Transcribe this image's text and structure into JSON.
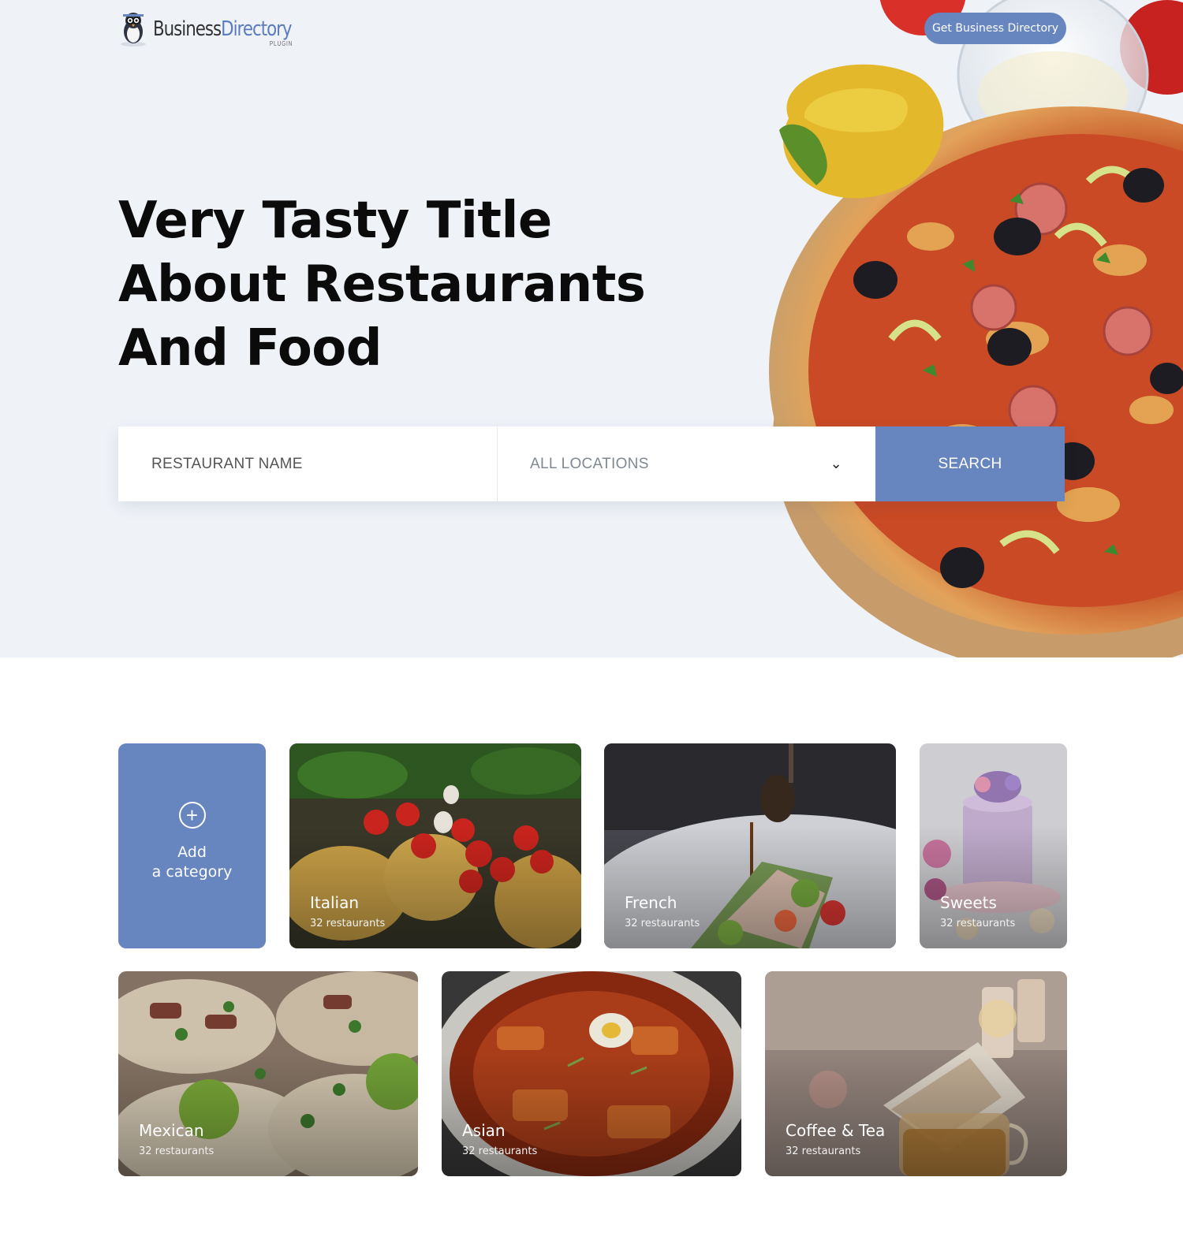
{
  "header": {
    "logo_primary": "Business",
    "logo_accent": "Directory",
    "logo_sub": "PLUGIN",
    "cta_label": "Get Business Directory"
  },
  "hero": {
    "title_lines": [
      "Very Tasty Title",
      "About Restaurants",
      "And Food"
    ]
  },
  "search": {
    "name_placeholder": "RESTAURANT NAME",
    "location_value": "ALL LOCATIONS",
    "button_label": "SEARCH"
  },
  "categories": {
    "add_line1": "Add",
    "add_line2": "a category",
    "items": [
      {
        "name": "Italian",
        "count": "32 restaurants"
      },
      {
        "name": "French",
        "count": "32 restaurants"
      },
      {
        "name": "Sweets",
        "count": "32 restaurants"
      },
      {
        "name": "Mexican",
        "count": "32 restaurants"
      },
      {
        "name": "Asian",
        "count": "32 restaurants"
      },
      {
        "name": "Coffee & Tea",
        "count": "32 restaurants"
      }
    ]
  },
  "colors": {
    "accent": "#6785bf",
    "hero_bg": "#eff2f7"
  }
}
